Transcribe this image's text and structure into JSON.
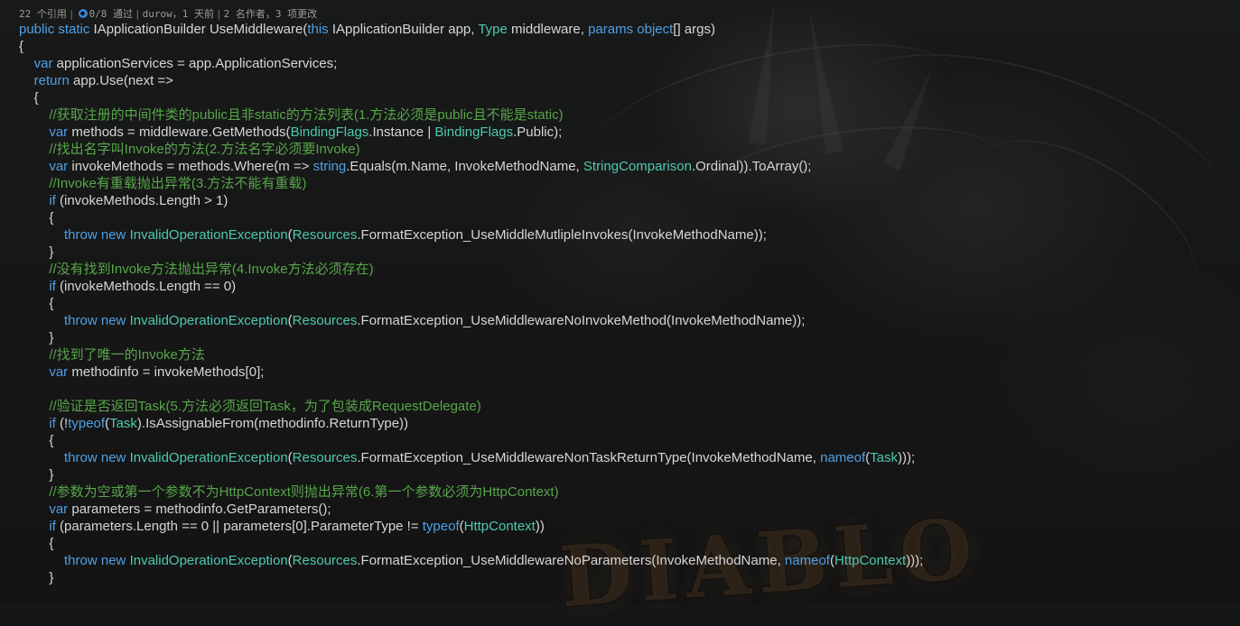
{
  "codelens": {
    "references": "22 个引用",
    "sep1": "|",
    "test_status": "0/8 通过",
    "sep2": "|",
    "author_time": "durow，1 天前",
    "sep3": "|",
    "authors_changes": "2 名作者，3 项更改"
  },
  "code_lines": [
    [
      {
        "t": "kw",
        "v": "public static "
      },
      {
        "t": "text",
        "v": "IApplicationBuilder UseMiddleware("
      },
      {
        "t": "kw",
        "v": "this "
      },
      {
        "t": "text",
        "v": "IApplicationBuilder app, "
      },
      {
        "t": "type",
        "v": "Type"
      },
      {
        "t": "text",
        "v": " middleware, "
      },
      {
        "t": "kw",
        "v": "params object"
      },
      {
        "t": "text",
        "v": "[] args)"
      }
    ],
    [
      {
        "t": "text",
        "v": "{"
      }
    ],
    [
      {
        "t": "text",
        "v": "    "
      },
      {
        "t": "kw",
        "v": "var"
      },
      {
        "t": "text",
        "v": " applicationServices = app.ApplicationServices;"
      }
    ],
    [
      {
        "t": "text",
        "v": "    "
      },
      {
        "t": "kw",
        "v": "return"
      },
      {
        "t": "text",
        "v": " app.Use(next =>"
      }
    ],
    [
      {
        "t": "text",
        "v": "    {"
      }
    ],
    [
      {
        "t": "text",
        "v": "        "
      },
      {
        "t": "comment",
        "v": "//获取注册的中间件类的public且非static的方法列表(1.方法必须是public且不能是static)"
      }
    ],
    [
      {
        "t": "text",
        "v": "        "
      },
      {
        "t": "kw",
        "v": "var"
      },
      {
        "t": "text",
        "v": " methods = middleware.GetMethods("
      },
      {
        "t": "type",
        "v": "BindingFlags"
      },
      {
        "t": "text",
        "v": ".Instance | "
      },
      {
        "t": "type",
        "v": "BindingFlags"
      },
      {
        "t": "text",
        "v": ".Public);"
      }
    ],
    [
      {
        "t": "text",
        "v": "        "
      },
      {
        "t": "comment",
        "v": "//找出名字叫Invoke的方法(2.方法名字必须要Invoke)"
      }
    ],
    [
      {
        "t": "text",
        "v": "        "
      },
      {
        "t": "kw",
        "v": "var"
      },
      {
        "t": "text",
        "v": " invokeMethods = methods.Where(m => "
      },
      {
        "t": "kw",
        "v": "string"
      },
      {
        "t": "text",
        "v": ".Equals(m.Name, InvokeMethodName, "
      },
      {
        "t": "type",
        "v": "StringComparison"
      },
      {
        "t": "text",
        "v": ".Ordinal)).ToArray();"
      }
    ],
    [
      {
        "t": "text",
        "v": "        "
      },
      {
        "t": "comment",
        "v": "//Invoke有重载抛出异常(3.方法不能有重载)"
      }
    ],
    [
      {
        "t": "text",
        "v": "        "
      },
      {
        "t": "kw",
        "v": "if"
      },
      {
        "t": "text",
        "v": " (invokeMethods.Length > 1)"
      }
    ],
    [
      {
        "t": "text",
        "v": "        {"
      }
    ],
    [
      {
        "t": "text",
        "v": "            "
      },
      {
        "t": "kw",
        "v": "throw new "
      },
      {
        "t": "type",
        "v": "InvalidOperationException"
      },
      {
        "t": "text",
        "v": "("
      },
      {
        "t": "type",
        "v": "Resources"
      },
      {
        "t": "text",
        "v": ".FormatException_UseMiddleMutlipleInvokes(InvokeMethodName));"
      }
    ],
    [
      {
        "t": "text",
        "v": "        }"
      }
    ],
    [
      {
        "t": "text",
        "v": "        "
      },
      {
        "t": "comment",
        "v": "//没有找到Invoke方法抛出异常(4.Invoke方法必须存在)"
      }
    ],
    [
      {
        "t": "text",
        "v": "        "
      },
      {
        "t": "kw",
        "v": "if"
      },
      {
        "t": "text",
        "v": " (invokeMethods.Length == 0)"
      }
    ],
    [
      {
        "t": "text",
        "v": "        {"
      }
    ],
    [
      {
        "t": "text",
        "v": "            "
      },
      {
        "t": "kw",
        "v": "throw new "
      },
      {
        "t": "type",
        "v": "InvalidOperationException"
      },
      {
        "t": "text",
        "v": "("
      },
      {
        "t": "type",
        "v": "Resources"
      },
      {
        "t": "text",
        "v": ".FormatException_UseMiddlewareNoInvokeMethod(InvokeMethodName));"
      }
    ],
    [
      {
        "t": "text",
        "v": "        }"
      }
    ],
    [
      {
        "t": "text",
        "v": "        "
      },
      {
        "t": "comment",
        "v": "//找到了唯一的Invoke方法"
      }
    ],
    [
      {
        "t": "text",
        "v": "        "
      },
      {
        "t": "kw",
        "v": "var"
      },
      {
        "t": "text",
        "v": " methodinfo = invokeMethods[0];"
      }
    ],
    [
      {
        "t": "text",
        "v": ""
      }
    ],
    [
      {
        "t": "text",
        "v": "        "
      },
      {
        "t": "comment",
        "v": "//验证是否返回Task(5.方法必须返回Task，为了包装成RequestDelegate)"
      }
    ],
    [
      {
        "t": "text",
        "v": "        "
      },
      {
        "t": "kw",
        "v": "if"
      },
      {
        "t": "text",
        "v": " (!"
      },
      {
        "t": "kw",
        "v": "typeof"
      },
      {
        "t": "text",
        "v": "("
      },
      {
        "t": "type",
        "v": "Task"
      },
      {
        "t": "text",
        "v": ").IsAssignableFrom(methodinfo.ReturnType))"
      }
    ],
    [
      {
        "t": "text",
        "v": "        {"
      }
    ],
    [
      {
        "t": "text",
        "v": "            "
      },
      {
        "t": "kw",
        "v": "throw new "
      },
      {
        "t": "type",
        "v": "InvalidOperationException"
      },
      {
        "t": "text",
        "v": "("
      },
      {
        "t": "type",
        "v": "Resources"
      },
      {
        "t": "text",
        "v": ".FormatException_UseMiddlewareNonTaskReturnType(InvokeMethodName, "
      },
      {
        "t": "kw",
        "v": "nameof"
      },
      {
        "t": "text",
        "v": "("
      },
      {
        "t": "type",
        "v": "Task"
      },
      {
        "t": "text",
        "v": ")));"
      }
    ],
    [
      {
        "t": "text",
        "v": "        }"
      }
    ],
    [
      {
        "t": "text",
        "v": "        "
      },
      {
        "t": "comment",
        "v": "//参数为空或第一个参数不为HttpContext则抛出异常(6.第一个参数必须为HttpContext)"
      }
    ],
    [
      {
        "t": "text",
        "v": "        "
      },
      {
        "t": "kw",
        "v": "var"
      },
      {
        "t": "text",
        "v": " parameters = methodinfo.GetParameters();"
      }
    ],
    [
      {
        "t": "text",
        "v": "        "
      },
      {
        "t": "kw",
        "v": "if"
      },
      {
        "t": "text",
        "v": " (parameters.Length == 0 || parameters[0].ParameterType != "
      },
      {
        "t": "kw",
        "v": "typeof"
      },
      {
        "t": "text",
        "v": "("
      },
      {
        "t": "type",
        "v": "HttpContext"
      },
      {
        "t": "text",
        "v": "))"
      }
    ],
    [
      {
        "t": "text",
        "v": "        {"
      }
    ],
    [
      {
        "t": "text",
        "v": "            "
      },
      {
        "t": "kw",
        "v": "throw new "
      },
      {
        "t": "type",
        "v": "InvalidOperationException"
      },
      {
        "t": "text",
        "v": "("
      },
      {
        "t": "type",
        "v": "Resources"
      },
      {
        "t": "text",
        "v": ".FormatException_UseMiddlewareNoParameters(InvokeMethodName, "
      },
      {
        "t": "kw",
        "v": "nameof"
      },
      {
        "t": "text",
        "v": "("
      },
      {
        "t": "type",
        "v": "HttpContext"
      },
      {
        "t": "text",
        "v": ")));"
      }
    ],
    [
      {
        "t": "text",
        "v": "        }"
      }
    ]
  ],
  "background_logo": "DIABLO",
  "colors": {
    "keyword": "#4ea0e6",
    "type": "#4ec9b0",
    "comment": "#57a64a",
    "text": "#d6d6d6",
    "codelens_text": "#9c9c9c",
    "test_icon": "#3e86d8"
  },
  "icons": {
    "test_status": "test-status-icon"
  }
}
